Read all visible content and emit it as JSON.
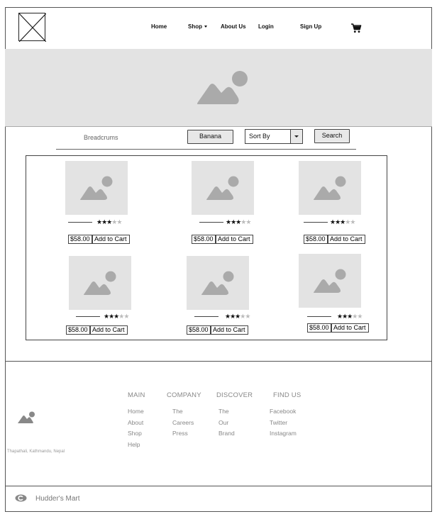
{
  "nav": {
    "home": "Home",
    "shop": "Shop",
    "about": "About Us",
    "login": "Login",
    "signup": "Sign Up"
  },
  "toolbar": {
    "breadcrumbs": "Breadcrums",
    "filter_label": "Banana",
    "sort_label": "Sort By",
    "search_label": "Search"
  },
  "products": [
    {
      "price": "$58.00",
      "cta": "Add to Cart",
      "rating": 3,
      "rating_max": 5
    },
    {
      "price": "$58.00",
      "cta": "Add to Cart",
      "rating": 3,
      "rating_max": 5
    },
    {
      "price": "$58.00",
      "cta": "Add to Cart",
      "rating": 3,
      "rating_max": 5
    },
    {
      "price": "$58.00",
      "cta": "Add to Cart",
      "rating": 3,
      "rating_max": 5
    },
    {
      "price": "$58.00",
      "cta": "Add to Cart",
      "rating": 3,
      "rating_max": 5
    },
    {
      "price": "$58.00",
      "cta": "Add to Cart",
      "rating": 3,
      "rating_max": 5
    }
  ],
  "footer": {
    "address": "Thapathali, Kathmandu, Nepal",
    "columns": [
      {
        "heading": "MAIN",
        "links": [
          "Home",
          "About",
          "Shop",
          "Help"
        ]
      },
      {
        "heading": "COMPANY",
        "links": [
          "The",
          "Careers",
          "Press"
        ]
      },
      {
        "heading": "DISCOVER",
        "links": [
          "The",
          "Our",
          "Brand"
        ]
      },
      {
        "heading": "FIND US",
        "links": [
          "Facebook",
          "Twitter",
          "Instagram"
        ]
      }
    ],
    "brand": "Hudder's Mart"
  },
  "icons": {
    "logo": "logo-placeholder-icon",
    "cart": "shopping-cart-icon",
    "image": "image-placeholder-icon",
    "copyright": "copyright-icon"
  },
  "colors": {
    "placeholder_bg": "#e3e3e3",
    "placeholder_fg": "#aaaaaa",
    "text_muted": "#888888"
  }
}
